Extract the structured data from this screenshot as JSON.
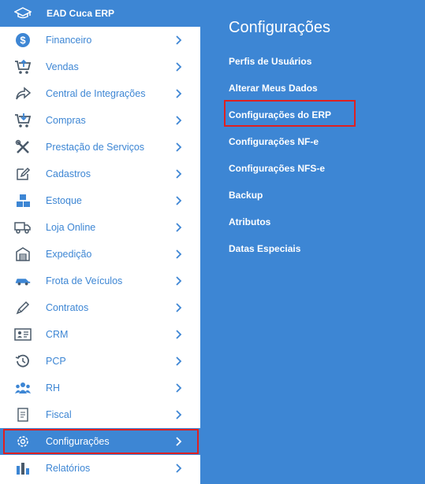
{
  "brand": {
    "title": "EAD Cuca ERP",
    "icon": "graduation-cap-icon"
  },
  "sidebar": {
    "items": [
      {
        "label": "Financeiro",
        "icon": "dollar-icon"
      },
      {
        "label": "Vendas",
        "icon": "cart-plus-icon"
      },
      {
        "label": "Central de Integrações",
        "icon": "share-icon"
      },
      {
        "label": "Compras",
        "icon": "cart-down-icon"
      },
      {
        "label": "Prestação de Serviços",
        "icon": "tools-icon"
      },
      {
        "label": "Cadastros",
        "icon": "edit-icon"
      },
      {
        "label": "Estoque",
        "icon": "boxes-icon"
      },
      {
        "label": "Loja Online",
        "icon": "truck-icon"
      },
      {
        "label": "Expedição",
        "icon": "warehouse-icon"
      },
      {
        "label": "Frota de Veículos",
        "icon": "car-icon"
      },
      {
        "label": "Contratos",
        "icon": "pen-icon"
      },
      {
        "label": "CRM",
        "icon": "contact-card-icon"
      },
      {
        "label": "PCP",
        "icon": "history-icon"
      },
      {
        "label": "RH",
        "icon": "users-icon"
      },
      {
        "label": "Fiscal",
        "icon": "receipt-icon"
      },
      {
        "label": "Configurações",
        "icon": "gear-icon"
      },
      {
        "label": "Relatórios",
        "icon": "bar-chart-icon"
      }
    ],
    "active_index": 15
  },
  "submenu": {
    "title": "Configurações",
    "links": [
      "Perfis de Usuários",
      "Alterar Meus Dados",
      "Configurações do ERP",
      "Configurações NF-e",
      "Configurações NFS-e",
      "Backup",
      "Atributos",
      "Datas Especiais"
    ],
    "highlight_index": 2
  },
  "colors": {
    "accent": "#3d86d4",
    "highlight_border": "#e02020",
    "white": "#ffffff",
    "icon_gray": "#4a5a6a"
  }
}
